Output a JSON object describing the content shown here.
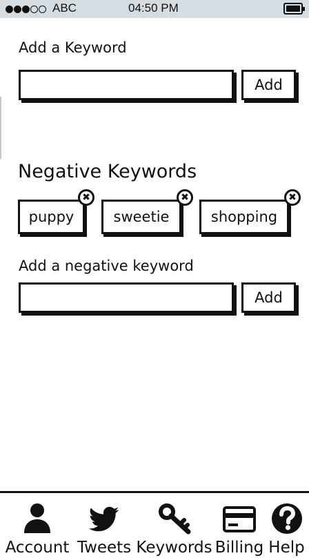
{
  "status_bar": {
    "signal_dots": [
      "full",
      "full",
      "full",
      "empty",
      "empty"
    ],
    "carrier": "ABC",
    "time": "04:50 PM",
    "battery_level": 1.0
  },
  "keyword_section": {
    "label": "Add a Keyword",
    "input_value": "",
    "add_label": "Add"
  },
  "negative_section": {
    "title": "Negative Keywords",
    "chips": [
      {
        "label": "puppy",
        "remove_icon": "close-circle-icon"
      },
      {
        "label": "sweetie",
        "remove_icon": "close-circle-icon"
      },
      {
        "label": "shopping",
        "remove_icon": "close-circle-icon"
      }
    ],
    "input_label": "Add a negative keyword",
    "input_value": "",
    "add_label": "Add"
  },
  "tab_bar": {
    "tabs": [
      {
        "label": "Account",
        "icon": "user-icon"
      },
      {
        "label": "Tweets",
        "icon": "twitter-bird-icon"
      },
      {
        "label": "Keywords",
        "icon": "key-icon"
      },
      {
        "label": "Billing",
        "icon": "credit-card-icon"
      },
      {
        "label": "Help",
        "icon": "help-icon"
      }
    ]
  }
}
